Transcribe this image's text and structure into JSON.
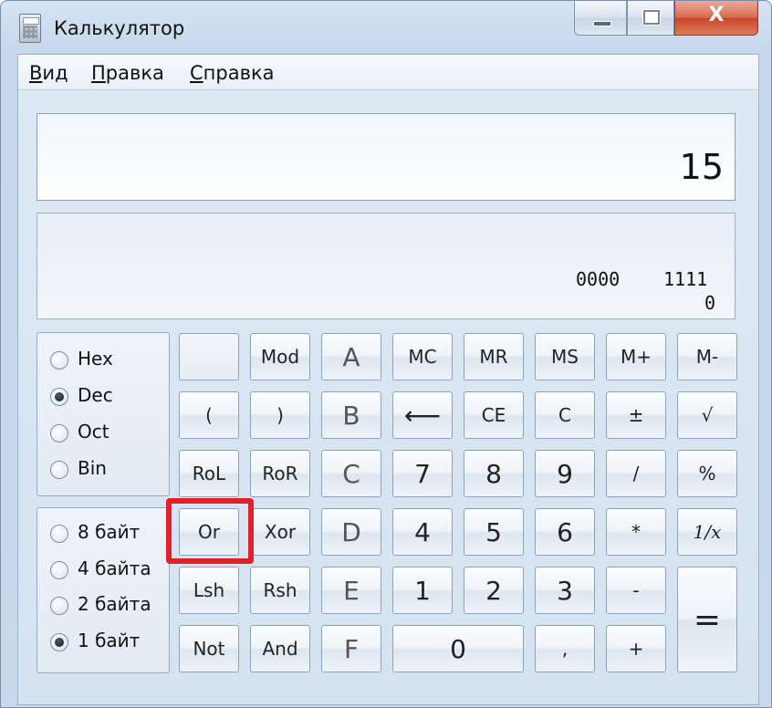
{
  "window": {
    "title": "Калькулятор",
    "close_glyph": "X"
  },
  "menu": [
    {
      "accel": "В",
      "rest": "ид"
    },
    {
      "accel": "П",
      "rest": "равка"
    },
    {
      "accel": "С",
      "rest": "правка"
    }
  ],
  "display": {
    "value": "15"
  },
  "bits": {
    "group_hi": "0000",
    "group_lo": "1111",
    "index": "0"
  },
  "radix": [
    "Hex",
    "Dec",
    "Oct",
    "Bin"
  ],
  "word_size": [
    "8 байт",
    "4 байта",
    "2 байта",
    "1 байт"
  ],
  "selected": {
    "radix": "Dec",
    "word_size": "1 байт"
  },
  "keys": {
    "blank": "",
    "mod": "Mod",
    "a": "A",
    "mc": "MC",
    "mr": "MR",
    "ms": "MS",
    "mplus": "M+",
    "mminus": "M-",
    "lparen": "(",
    "rparen": ")",
    "b": "B",
    "backspace": "⟵",
    "ce": "CE",
    "c": "C",
    "plusminus": "±",
    "sqrt": "√",
    "rol": "RoL",
    "ror": "RoR",
    "cc": "C",
    "n7": "7",
    "n8": "8",
    "n9": "9",
    "div": "/",
    "percent": "%",
    "or": "Or",
    "xor": "Xor",
    "d": "D",
    "n4": "4",
    "n5": "5",
    "n6": "6",
    "mul": "*",
    "reciprocal": "1/x",
    "lsh": "Lsh",
    "rsh": "Rsh",
    "e": "E",
    "n1": "1",
    "n2": "2",
    "n3": "3",
    "minus": "-",
    "equals": "=",
    "not": "Not",
    "and": "And",
    "f": "F",
    "n0": "0",
    "comma": ",",
    "plus": "+"
  },
  "colors": {
    "highlight": "#e0202a"
  }
}
